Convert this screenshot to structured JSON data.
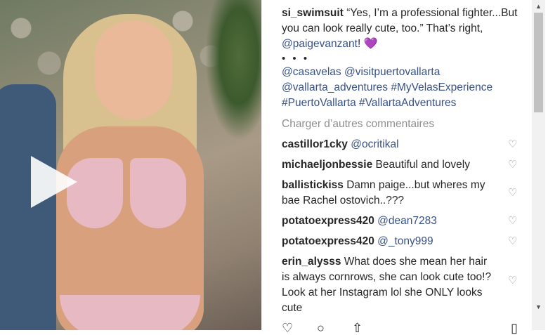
{
  "post": {
    "caption": {
      "username": "si_swimsuit",
      "text_part1": "“Yes, I’m a professional fighter...But you can look really cute, too.” That’s right, ",
      "mention": "@paigevanzant",
      "text_part2": "!",
      "emoji": "💜",
      "dots": "• • •",
      "tags": "@casavelas @visitpuertovallarta @vallarta_adventures #MyVelasExperience #PuertoVallarta #VallartaAdventures"
    },
    "load_more": "Charger d’autres commentaires",
    "comments": [
      {
        "user": "castillor1cky",
        "text": "@ocritikal",
        "is_link": true
      },
      {
        "user": "michaeljonbessie",
        "text": "Beautiful and lovely",
        "is_link": false
      },
      {
        "user": "ballistickiss",
        "text": "Damn paige...but wheres my bae Rachel ostovich..???",
        "is_link": false
      },
      {
        "user": "potatoexpress420",
        "text": "@dean7283",
        "is_link": true
      },
      {
        "user": "potatoexpress420",
        "text": "@_tony999",
        "is_link": true
      },
      {
        "user": "erin_alysss",
        "text": "What does she mean her hair is always cornrows, she can look cute too!? Look at her Instagram lol she ONLY looks cute",
        "is_link": false
      }
    ],
    "icons": {
      "like": "heart-outline-icon",
      "comment": "comment-bubble-icon",
      "share": "share-icon",
      "save": "bookmark-icon"
    }
  }
}
